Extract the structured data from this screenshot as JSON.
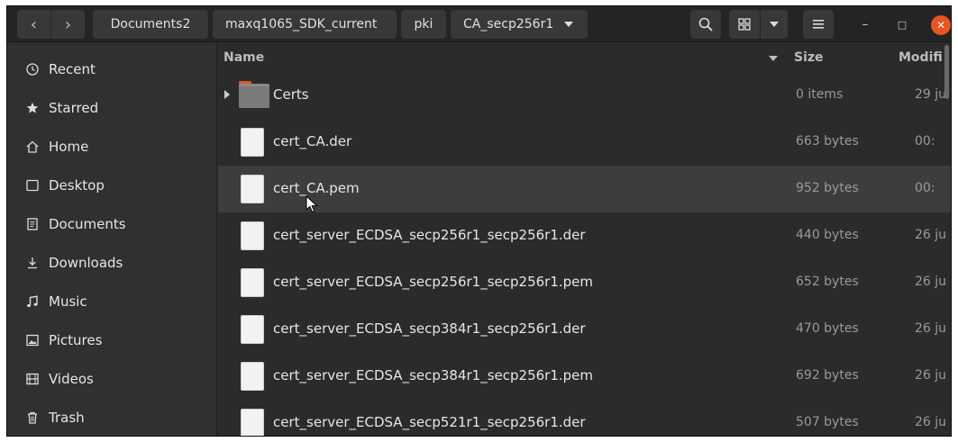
{
  "header": {
    "back_glyph": "‹",
    "forward_glyph": "›",
    "breadcrumbs": [
      "Documents2",
      "maxq1065_SDK_current",
      "pki",
      "CA_secp256r1"
    ],
    "search_icon": "search-icon",
    "view_icon": "grid-view-icon",
    "menu_icon": "hamburger-icon",
    "minimize_glyph": "–",
    "maximize_glyph": "□",
    "close_glyph": "✕"
  },
  "sidebar": {
    "items": [
      {
        "label": "Recent",
        "icon": "clock-icon"
      },
      {
        "label": "Starred",
        "icon": "star-icon"
      },
      {
        "label": "Home",
        "icon": "home-icon"
      },
      {
        "label": "Desktop",
        "icon": "desktop-icon"
      },
      {
        "label": "Documents",
        "icon": "document-icon"
      },
      {
        "label": "Downloads",
        "icon": "download-icon"
      },
      {
        "label": "Music",
        "icon": "music-icon"
      },
      {
        "label": "Pictures",
        "icon": "picture-icon"
      },
      {
        "label": "Videos",
        "icon": "video-icon"
      },
      {
        "label": "Trash",
        "icon": "trash-icon"
      }
    ]
  },
  "columns": {
    "name": "Name",
    "size": "Size",
    "modified": "Modifi"
  },
  "files": [
    {
      "name": "Certs",
      "size": "0 items",
      "modified": "29 ju",
      "type": "folder"
    },
    {
      "name": "cert_CA.der",
      "size": "663 bytes",
      "modified": "00:",
      "type": "file"
    },
    {
      "name": "cert_CA.pem",
      "size": "952 bytes",
      "modified": "00:",
      "type": "file"
    },
    {
      "name": "cert_server_ECDSA_secp256r1_secp256r1.der",
      "size": "440 bytes",
      "modified": "26 ju",
      "type": "file"
    },
    {
      "name": "cert_server_ECDSA_secp256r1_secp256r1.pem",
      "size": "652 bytes",
      "modified": "26 ju",
      "type": "file"
    },
    {
      "name": "cert_server_ECDSA_secp384r1_secp256r1.der",
      "size": "470 bytes",
      "modified": "26 ju",
      "type": "file"
    },
    {
      "name": "cert_server_ECDSA_secp384r1_secp256r1.pem",
      "size": "692 bytes",
      "modified": "26 ju",
      "type": "file"
    },
    {
      "name": "cert_server_ECDSA_secp521r1_secp256r1.der",
      "size": "507 bytes",
      "modified": "26 ju",
      "type": "file"
    }
  ],
  "colors": {
    "accent_close": "#e95420",
    "folder": "#8a8a8a",
    "folder_tab": "#e0552a"
  }
}
